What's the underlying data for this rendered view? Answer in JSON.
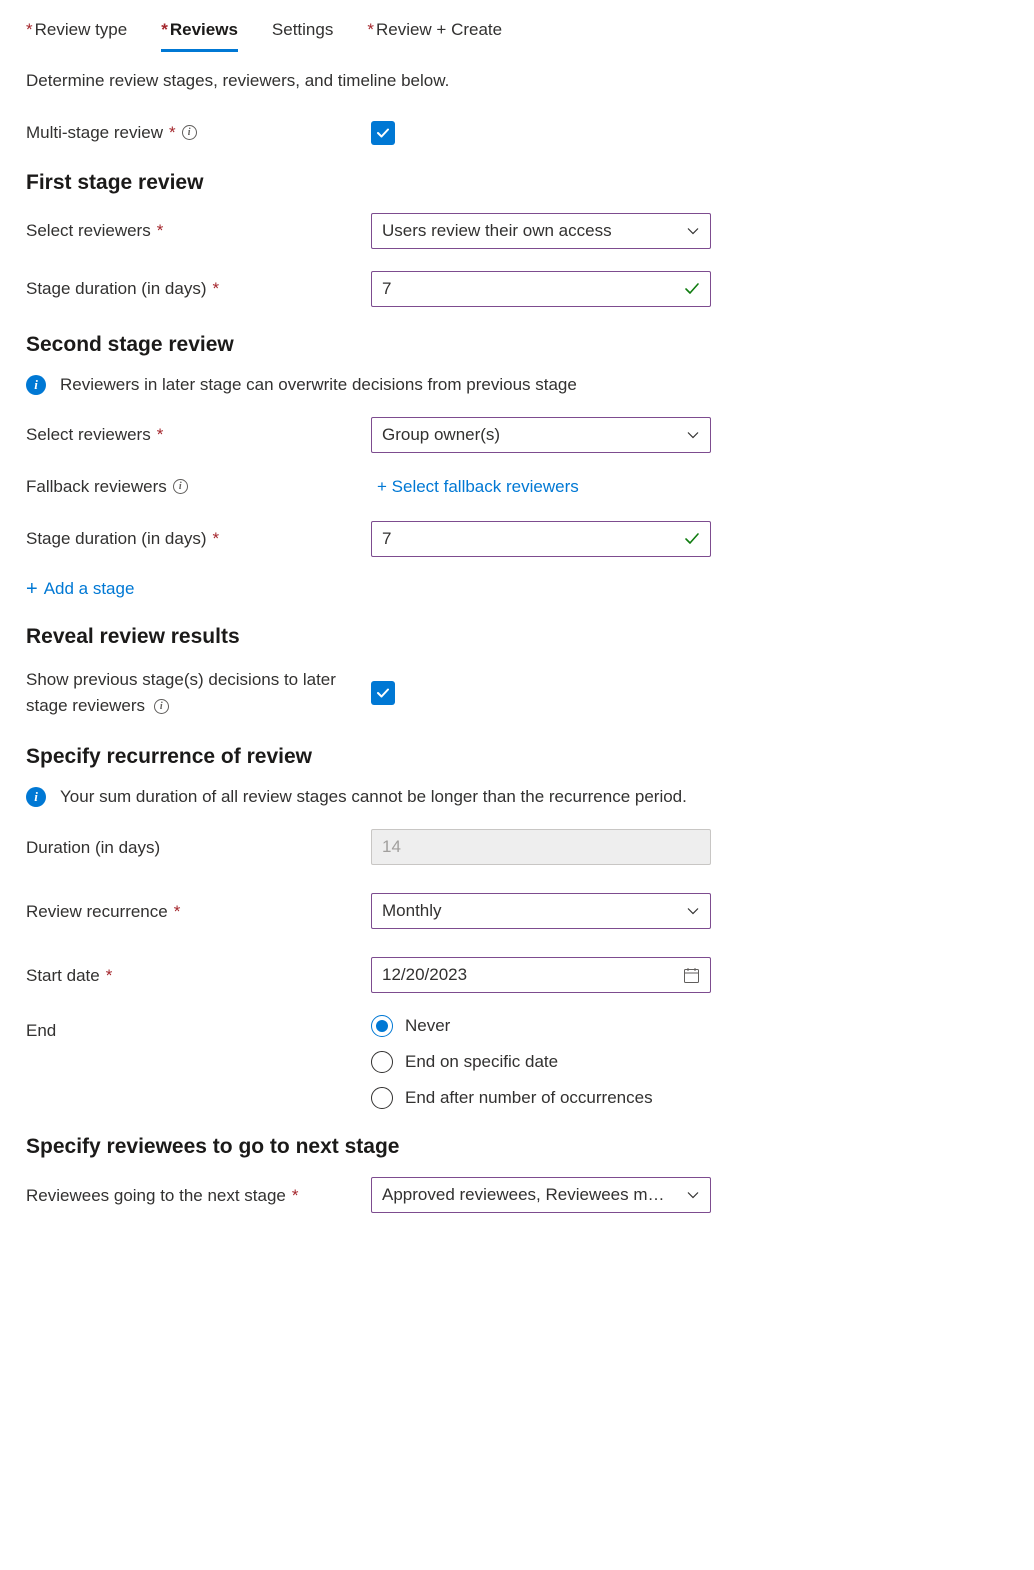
{
  "tabs": {
    "review_type": "Review type",
    "reviews": "Reviews",
    "settings": "Settings",
    "review_create": "Review + Create"
  },
  "intro": "Determine review stages, reviewers, and timeline below.",
  "multi_stage": {
    "label": "Multi-stage review",
    "checked": true
  },
  "first_stage": {
    "heading": "First stage review",
    "select_reviewers_label": "Select reviewers",
    "select_reviewers_value": "Users review their own access",
    "duration_label": "Stage duration (in days)",
    "duration_value": "7"
  },
  "second_stage": {
    "heading": "Second stage review",
    "info": "Reviewers in later stage can overwrite decisions from previous stage",
    "select_reviewers_label": "Select reviewers",
    "select_reviewers_value": "Group owner(s)",
    "fallback_label": "Fallback reviewers",
    "fallback_link": "+ Select fallback reviewers",
    "duration_label": "Stage duration (in days)",
    "duration_value": "7",
    "add_stage": "Add a stage"
  },
  "reveal": {
    "heading": "Reveal review results",
    "label": "Show previous stage(s) decisions to later stage reviewers",
    "checked": true
  },
  "recurrence": {
    "heading": "Specify recurrence of review",
    "info": "Your sum duration of all review stages cannot be longer than the recurrence period.",
    "duration_label": "Duration (in days)",
    "duration_value": "14",
    "recurrence_label": "Review recurrence",
    "recurrence_value": "Monthly",
    "start_label": "Start date",
    "start_value": "12/20/2023",
    "end_label": "End",
    "end_options": {
      "never": "Never",
      "end_date": "End on specific date",
      "end_occurrences": "End after number of occurrences"
    },
    "end_selected": "never"
  },
  "next_stage": {
    "heading": "Specify reviewees to go to next stage",
    "label": "Reviewees going to the next stage",
    "value": "Approved reviewees, Reviewees m…"
  }
}
